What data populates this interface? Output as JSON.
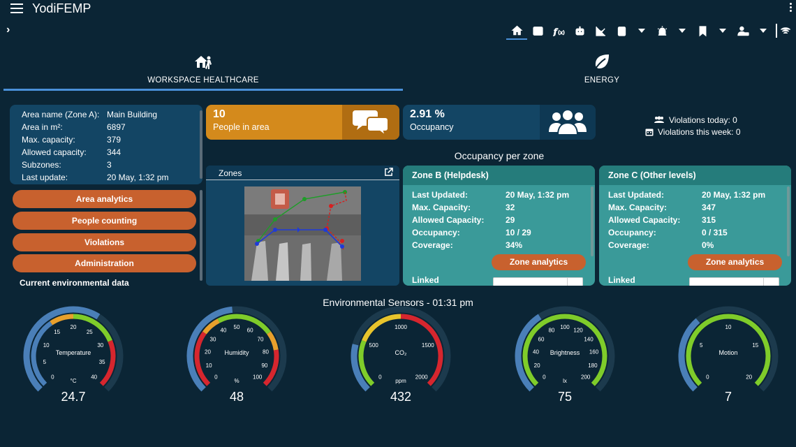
{
  "app": {
    "title": "YodiFEMP"
  },
  "tabs": [
    {
      "label": "WORKSPACE HEALTHCARE"
    },
    {
      "label": "ENERGY"
    }
  ],
  "area": {
    "rows": [
      {
        "key": "Area name (Zone A):",
        "value": "Main Building"
      },
      {
        "key": "Area in m²:",
        "value": "6897"
      },
      {
        "key": "Max. capacity:",
        "value": "379"
      },
      {
        "key": "Allowed capacity:",
        "value": "344"
      },
      {
        "key": "Subzones:",
        "value": "3"
      },
      {
        "key": "Last update:",
        "value": "20 May, 1:32 pm"
      }
    ]
  },
  "nav": [
    "Area analytics",
    "People counting",
    "Violations",
    "Administration"
  ],
  "env_title": "Current environmental data",
  "kpi": {
    "people": {
      "value": "10",
      "label": "People in area"
    },
    "occupancy": {
      "value": "2.91 %",
      "label": "Occupancy"
    }
  },
  "violations": {
    "today": "Violations today: 0",
    "week": "Violations this week: 0"
  },
  "occupancy_title": "Occupancy per zone",
  "zones_panel": {
    "title": "Zones"
  },
  "zone_cards": [
    {
      "title": "Zone B (Helpdesk)",
      "rows": [
        {
          "key": "Last Updated:",
          "value": "20 May, 1:32 pm"
        },
        {
          "key": "Max. Capacity:",
          "value": "32"
        },
        {
          "key": "Allowed Capacity:",
          "value": "29"
        },
        {
          "key": "Occupancy:",
          "value": "10 / 29"
        },
        {
          "key": "Coverage:",
          "value": "34%"
        }
      ],
      "button": "Zone analytics",
      "linked": "Linked"
    },
    {
      "title": "Zone C (Other levels)",
      "rows": [
        {
          "key": "Last Updated:",
          "value": "20 May, 1:32 pm"
        },
        {
          "key": "Max. Capacity:",
          "value": "347"
        },
        {
          "key": "Allowed Capacity:",
          "value": "315"
        },
        {
          "key": "Occupancy:",
          "value": "0 / 315"
        },
        {
          "key": "Coverage:",
          "value": "0%"
        }
      ],
      "button": "Zone analytics",
      "linked": "Linked"
    }
  ],
  "sensors_title": "Environmental Sensors - 01:31 pm",
  "gauges": [
    {
      "name": "Temperature",
      "unit": "°C",
      "value": "24.7",
      "ticks": [
        "0",
        "5",
        "10",
        "15",
        "20",
        "25",
        "30",
        "35",
        "40"
      ],
      "level": 0.62,
      "bands": [
        {
          "from": 0,
          "to": 0.375,
          "color": "#4a7fb8"
        },
        {
          "from": 0.375,
          "to": 0.5,
          "color": "#e8a02c"
        },
        {
          "from": 0.5,
          "to": 0.75,
          "color": "#7fcc2a"
        },
        {
          "from": 0.75,
          "to": 1,
          "color": "#d6262e"
        }
      ]
    },
    {
      "name": "Humidity",
      "unit": "%",
      "value": "48",
      "ticks": [
        "0",
        "10",
        "20",
        "30",
        "40",
        "50",
        "60",
        "70",
        "80",
        "90",
        "100"
      ],
      "level": 0.48,
      "bands": [
        {
          "from": 0,
          "to": 0.3,
          "color": "#d6262e"
        },
        {
          "from": 0.3,
          "to": 0.4,
          "color": "#e8a02c"
        },
        {
          "from": 0.4,
          "to": 0.7,
          "color": "#7fcc2a"
        },
        {
          "from": 0.7,
          "to": 0.8,
          "color": "#e8a02c"
        },
        {
          "from": 0.8,
          "to": 1,
          "color": "#d6262e"
        }
      ]
    },
    {
      "name": "CO₂",
      "unit": "ppm",
      "value": "432",
      "ticks": [
        "0",
        "500",
        "1000",
        "1500",
        "2000"
      ],
      "level": 0.22,
      "bands": [
        {
          "from": 0,
          "to": 0.25,
          "color": "#7fcc2a"
        },
        {
          "from": 0.25,
          "to": 0.5,
          "color": "#e8c42c"
        },
        {
          "from": 0.5,
          "to": 1,
          "color": "#d6262e"
        }
      ]
    },
    {
      "name": "Brightness",
      "unit": "lx",
      "value": "75",
      "ticks": [
        "0",
        "20",
        "40",
        "60",
        "80",
        "100",
        "120",
        "140",
        "160",
        "180",
        "200"
      ],
      "level": 0.38,
      "bands": [
        {
          "from": 0,
          "to": 1,
          "color": "#7fcc2a"
        }
      ]
    },
    {
      "name": "Motion",
      "unit": "",
      "value": "7",
      "ticks": [
        "0",
        "5",
        "10",
        "15",
        "20"
      ],
      "level": 0.35,
      "bands": [
        {
          "from": 0,
          "to": 1,
          "color": "#7fcc2a"
        }
      ]
    }
  ]
}
